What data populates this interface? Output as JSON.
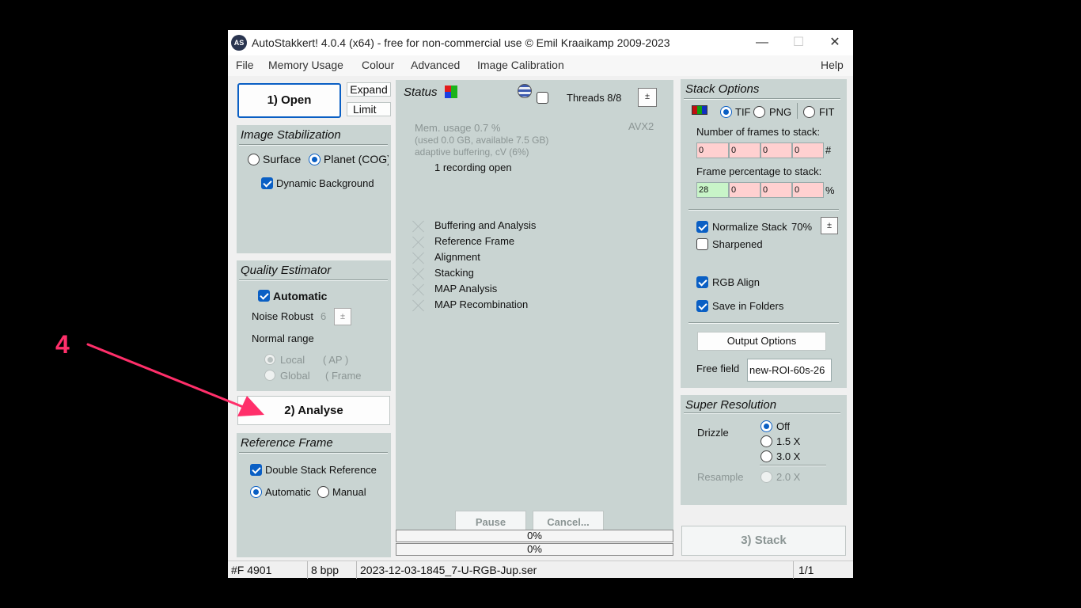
{
  "titlebar": {
    "icon_text": "AS",
    "title": "AutoStakkert! 4.0.4 (x64) - free for non-commercial use © Emil Kraaikamp 2009-2023",
    "minimize": "—",
    "maximize": "☐",
    "close": "✕"
  },
  "menu": {
    "file": "File",
    "memory": "Memory Usage",
    "colour": "Colour",
    "advanced": "Advanced",
    "calibration": "Image Calibration",
    "help": "Help"
  },
  "left": {
    "open_button": "1) Open",
    "expand_button": "Expand",
    "limit_button": "Limit",
    "stabilization": {
      "title": "Image Stabilization",
      "surface": "Surface",
      "planet": "Planet (COG)",
      "dynamic_background": "Dynamic Background"
    },
    "quality": {
      "title": "Quality Estimator",
      "automatic": "Automatic",
      "noise_robust": "Noise Robust",
      "noise_value": "6",
      "normal_range": "Normal range",
      "local": "Local",
      "local_ap": "( AP )",
      "global": "Global",
      "global_frame": "( Frame"
    },
    "analyse_button": "2) Analyse",
    "reference": {
      "title": "Reference Frame",
      "double_stack": "Double Stack Reference",
      "automatic": "Automatic",
      "manual": "Manual"
    }
  },
  "middle": {
    "status_title": "Status",
    "threads": "Threads 8/8",
    "mem_usage": "Mem. usage 0.7 %",
    "mem_detail": "(used 0.0 GB, available 7.5 GB)",
    "buffering": "adaptive buffering, cV (6%)",
    "avx": "AVX2",
    "recording": "1 recording open",
    "steps": [
      "Buffering and Analysis",
      "Reference Frame",
      "Alignment",
      "Stacking",
      "MAP Analysis",
      "MAP Recombination"
    ],
    "pause_button": "Pause",
    "cancel_button": "Cancel...",
    "dot": ".",
    "progress1": "0%",
    "progress2": "0%"
  },
  "right": {
    "stack": {
      "title": "Stack Options",
      "tif": "TIF",
      "png": "PNG",
      "fit": "FIT",
      "num_frames_label": "Number of frames to stack:",
      "num_frames": [
        "0",
        "0",
        "0",
        "0"
      ],
      "hash": "#",
      "frame_pct_label": "Frame percentage to stack:",
      "frame_pct": [
        "28",
        "0",
        "0",
        "0"
      ],
      "percent": "%",
      "normalize": "Normalize Stack",
      "normalize_value": "70%",
      "sharpened": "Sharpened",
      "rgb_align": "RGB Align",
      "save_folders": "Save in Folders",
      "output_options": "Output Options",
      "free_field_label": "Free field",
      "free_field_value": "new-ROI-60s-26"
    },
    "super": {
      "title": "Super Resolution",
      "drizzle": "Drizzle",
      "off": "Off",
      "x15": "1.5 X",
      "x30": "3.0 X",
      "resample": "Resample",
      "x20": "2.0 X"
    },
    "stack_button": "3) Stack"
  },
  "statusbar": {
    "frames": "#F 4901",
    "bpp": "8 bpp",
    "file": "2023-12-03-1845_7-U-RGB-Jup.ser",
    "page": "1/1"
  },
  "annotation": {
    "number": "4",
    "color": "#ff2f6a"
  },
  "colors": {
    "panel": "#c9d4d2",
    "accent": "#0a5fc4"
  }
}
